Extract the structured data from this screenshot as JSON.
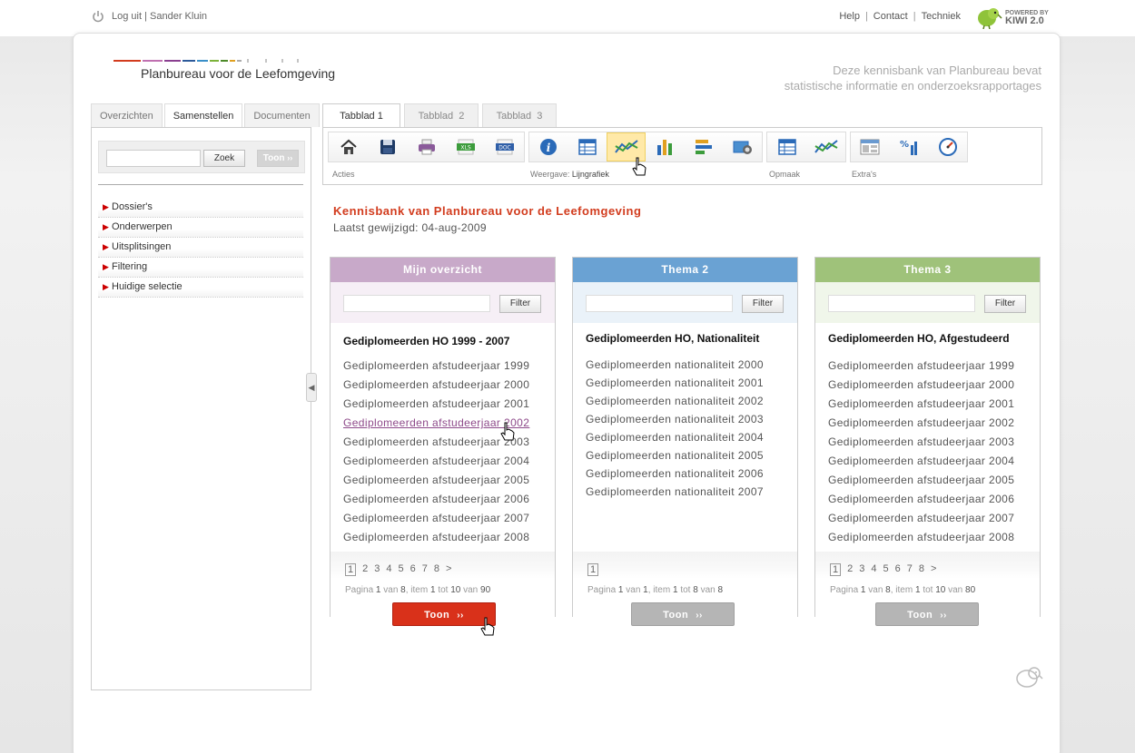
{
  "topbar": {
    "logout": "Log uit",
    "separator": "|",
    "user": "Sander Kluin",
    "links": [
      "Help",
      "Contact",
      "Techniek"
    ],
    "powered_by": "POWERED BY",
    "kiwi_version": "KIWI 2.0"
  },
  "header": {
    "logo_name": "Planbureau voor de Leefomgeving",
    "tagline_line1": "Deze kennisbank van Planbureau bevat",
    "tagline_line2": "statistische informatie en onderzoeksrapportages"
  },
  "left": {
    "tabs": [
      "Overzichten",
      "Samenstellen",
      "Documenten"
    ],
    "active_tab": "Samenstellen",
    "search_button": "Zoek",
    "toon_button": "Toon",
    "nav_items": [
      "Dossier's",
      "Onderwerpen",
      "Uitsplitsingen",
      "Filtering",
      "Huidige selectie"
    ]
  },
  "right": {
    "tabs": [
      "Tabblad 1",
      "Tabblad  2",
      "Tabblad  3"
    ],
    "toolbar": {
      "acties_label": "Acties",
      "weergave_label": "Weergave:",
      "weergave_value": "Lijngrafiek",
      "opmaak_label": "Opmaak",
      "extras_label": "Extra's",
      "icons_acties": [
        "home-icon",
        "save-icon",
        "print-icon",
        "xls-export-icon",
        "doc-export-icon"
      ],
      "icons_weergave": [
        "info-icon",
        "table-icon",
        "line-chart-icon",
        "bar-chart-icon",
        "horizontal-bar-icon",
        "map-icon"
      ],
      "icons_opmaak": [
        "table-format-icon",
        "line-format-icon"
      ],
      "icons_extras": [
        "layout-icon",
        "percentage-icon",
        "dashboard-icon"
      ]
    },
    "title": "Kennisbank van Planbureau voor de Leefomgeving",
    "last_modified": "Laatst gewijzigd: 04-aug-2009"
  },
  "cards": [
    {
      "header": "Mijn overzicht",
      "color": "#c8a9c9",
      "filter_label": "Filter",
      "subtitle": "Gediplomeerden HO 1999 - 2007",
      "items": [
        "Gediplomeerden afstudeerjaar 1999",
        "Gediplomeerden afstudeerjaar 2000",
        "Gediplomeerden afstudeerjaar 2001",
        "Gediplomeerden afstudeerjaar 2002",
        "Gediplomeerden afstudeerjaar 2003",
        "Gediplomeerden afstudeerjaar 2004",
        "Gediplomeerden afstudeerjaar 2005",
        "Gediplomeerden afstudeerjaar 2006",
        "Gediplomeerden afstudeerjaar 2007",
        "Gediplomeerden afstudeerjaar 2008"
      ],
      "pages": [
        "1",
        "2",
        "3",
        "4",
        "5",
        "6",
        "7",
        "8",
        ">"
      ],
      "pinfo": {
        "a": "Pagina",
        "b": "1",
        "c": "van",
        "d": "8",
        "e": ", item",
        "f": "1",
        "g": "tot",
        "h": "10",
        "i": "van",
        "j": "90"
      },
      "toon": "Toon",
      "toon_color": "#d9311a"
    },
    {
      "header": "Thema 2",
      "color": "#6aa2d3",
      "filter_label": "Filter",
      "subtitle": "Gediplomeerden HO, Nationaliteit",
      "items": [
        "Gediplomeerden nationaliteit 2000",
        "Gediplomeerden nationaliteit 2001",
        "Gediplomeerden nationaliteit 2002",
        "Gediplomeerden nationaliteit 2003",
        "Gediplomeerden nationaliteit 2004",
        "Gediplomeerden nationaliteit 2005",
        "Gediplomeerden nationaliteit 2006",
        "Gediplomeerden nationaliteit 2007"
      ],
      "pages": [
        "1"
      ],
      "pinfo": {
        "a": "Pagina",
        "b": "1",
        "c": "van",
        "d": "1",
        "e": ", item",
        "f": "1",
        "g": "tot",
        "h": "8",
        "i": "van",
        "j": "8"
      },
      "toon": "Toon",
      "toon_color": "#b5b5b5"
    },
    {
      "header": "Thema 3",
      "color": "#9fc27a",
      "filter_label": "Filter",
      "subtitle": "Gediplomeerden HO, Afgestudeerd",
      "items": [
        "Gediplomeerden afstudeerjaar 1999",
        "Gediplomeerden afstudeerjaar 2000",
        "Gediplomeerden afstudeerjaar 2001",
        "Gediplomeerden afstudeerjaar 2002",
        "Gediplomeerden afstudeerjaar 2003",
        "Gediplomeerden afstudeerjaar 2004",
        "Gediplomeerden afstudeerjaar 2005",
        "Gediplomeerden afstudeerjaar 2006",
        "Gediplomeerden afstudeerjaar 2007",
        "Gediplomeerden afstudeerjaar 2008"
      ],
      "pages": [
        "1",
        "2",
        "3",
        "4",
        "5",
        "6",
        "7",
        "8",
        ">"
      ],
      "pinfo": {
        "a": "Pagina",
        "b": "1",
        "c": "van",
        "d": "8",
        "e": ", item",
        "f": "1",
        "g": "tot",
        "h": "10",
        "i": "van",
        "j": "80"
      },
      "toon": "Toon",
      "toon_color": "#b5b5b5"
    }
  ]
}
